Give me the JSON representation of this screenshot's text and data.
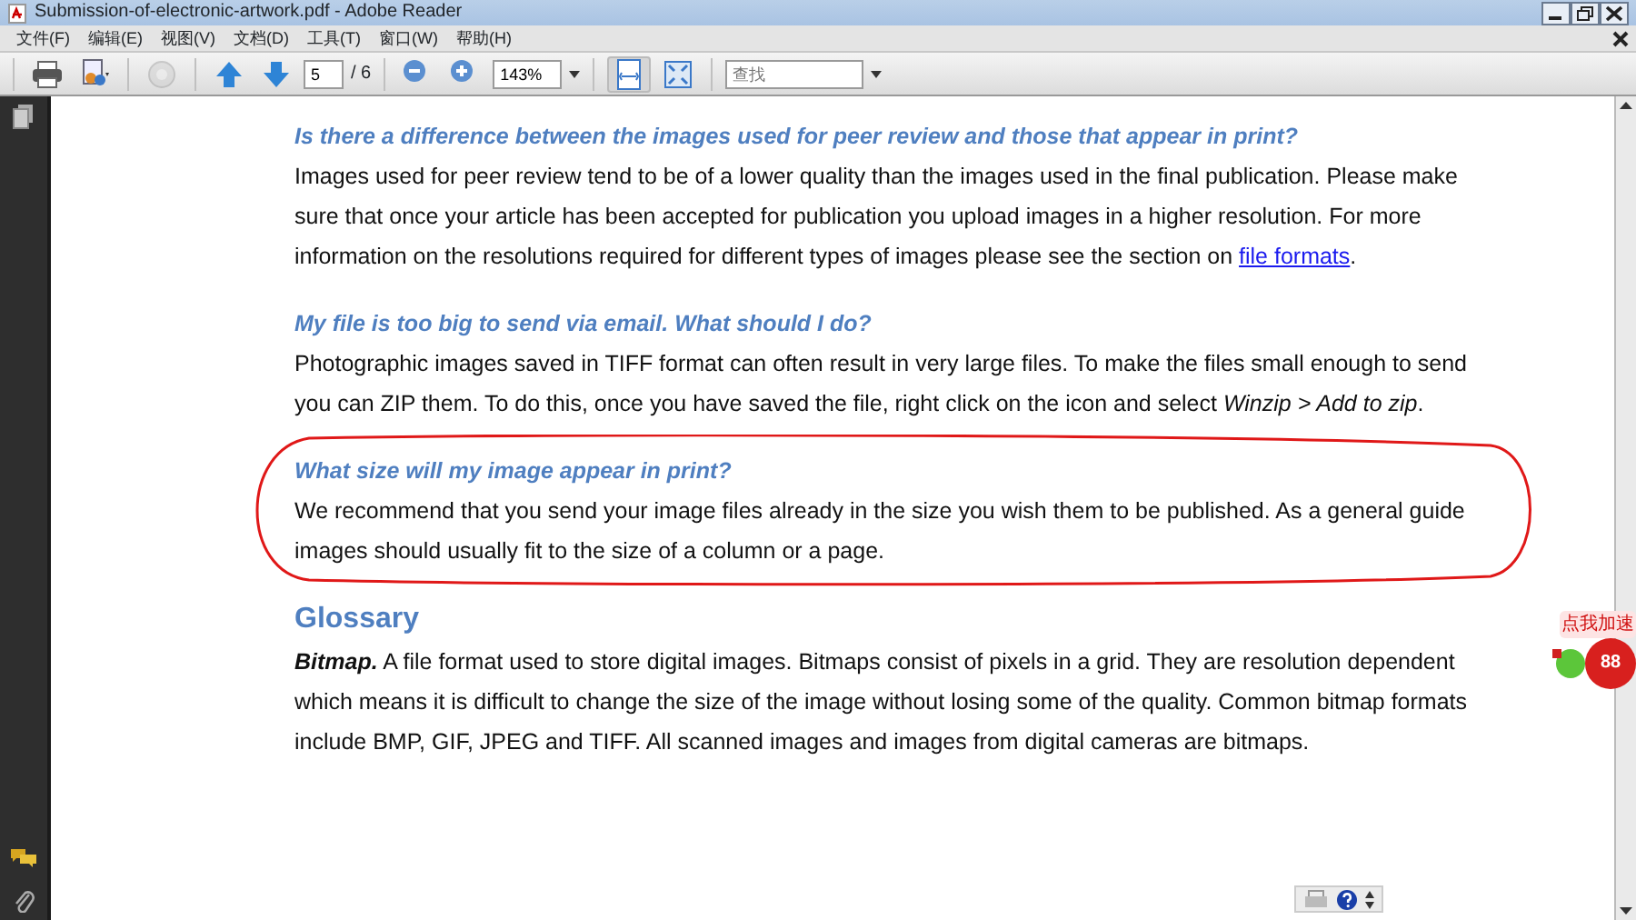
{
  "window": {
    "title": "Submission-of-electronic-artwork.pdf - Adobe Reader"
  },
  "menu": [
    "文件(F)",
    "编辑(E)",
    "视图(V)",
    "文档(D)",
    "工具(T)",
    "窗口(W)",
    "帮助(H)"
  ],
  "toolbar": {
    "buttons": [
      {
        "kind": "print",
        "disabled": false,
        "selected": false
      },
      {
        "kind": "create",
        "disabled": false,
        "selected": false
      },
      {
        "kind": "collaborate",
        "disabled": true,
        "selected": false
      },
      {
        "kind": "prev",
        "disabled": false,
        "selected": false
      },
      {
        "kind": "next",
        "disabled": false,
        "selected": false
      }
    ],
    "page_field": {
      "value": "5"
    },
    "page_total": "/ 6",
    "zoom_buttons": [
      {
        "kind": "zoom-out"
      },
      {
        "kind": "zoom-in"
      }
    ],
    "zoom_field": {
      "value": "143%"
    },
    "view_buttons": [
      {
        "kind": "fit-page",
        "selected": true
      },
      {
        "kind": "full-screen",
        "selected": false
      }
    ],
    "search": {
      "placeholder": "查找"
    }
  },
  "sections": [
    {
      "kind": "question",
      "title": "Is there a difference between the images used for peer review and those that appear in print?",
      "parts": [
        {
          "kind": "text",
          "text": "Images used for peer review tend to be of a lower quality than the images used in the final publication. Please make sure that once your article has been accepted for publication you upload images in a higher resolution. For more information on the resolutions required for different types of images please see the section on "
        },
        {
          "kind": "link",
          "text": "file formats"
        },
        {
          "kind": "text",
          "text": "."
        }
      ],
      "circled": false
    },
    {
      "kind": "question",
      "title": "My file is too big to send via email. What should I do?",
      "parts": [
        {
          "kind": "text",
          "text": "Photographic images saved in TIFF format can often result in very large files. To make the files small enough to send you can ZIP them. To do this, once you have saved the file, right click on the icon and select *Winzip > Add to zip*."
        }
      ],
      "circled": false
    },
    {
      "kind": "question",
      "title": "What size will my image appear in print?",
      "parts": [
        {
          "kind": "text",
          "text": "We recommend that you send your image files already in the size you wish them to be published. As a general guide images should usually fit to the size of a column or a page."
        }
      ],
      "circled": true
    },
    {
      "kind": "heading",
      "title": "Glossary",
      "circled": false
    },
    {
      "kind": "term",
      "title": "Bitmap.",
      "parts": [
        {
          "kind": "text",
          "text": "A file format used to store digital images. Bitmaps consist of pixels in a grid. They are resolution dependent which means it is difficult to change the size of the image without losing some of the quality. Common bitmap formats include BMP, GIF, JPEG and TIFF. All scanned images and images from digital cameras are bitmaps."
        }
      ],
      "circled": false
    }
  ],
  "widget": {
    "label": "点我加速",
    "count": "88"
  }
}
